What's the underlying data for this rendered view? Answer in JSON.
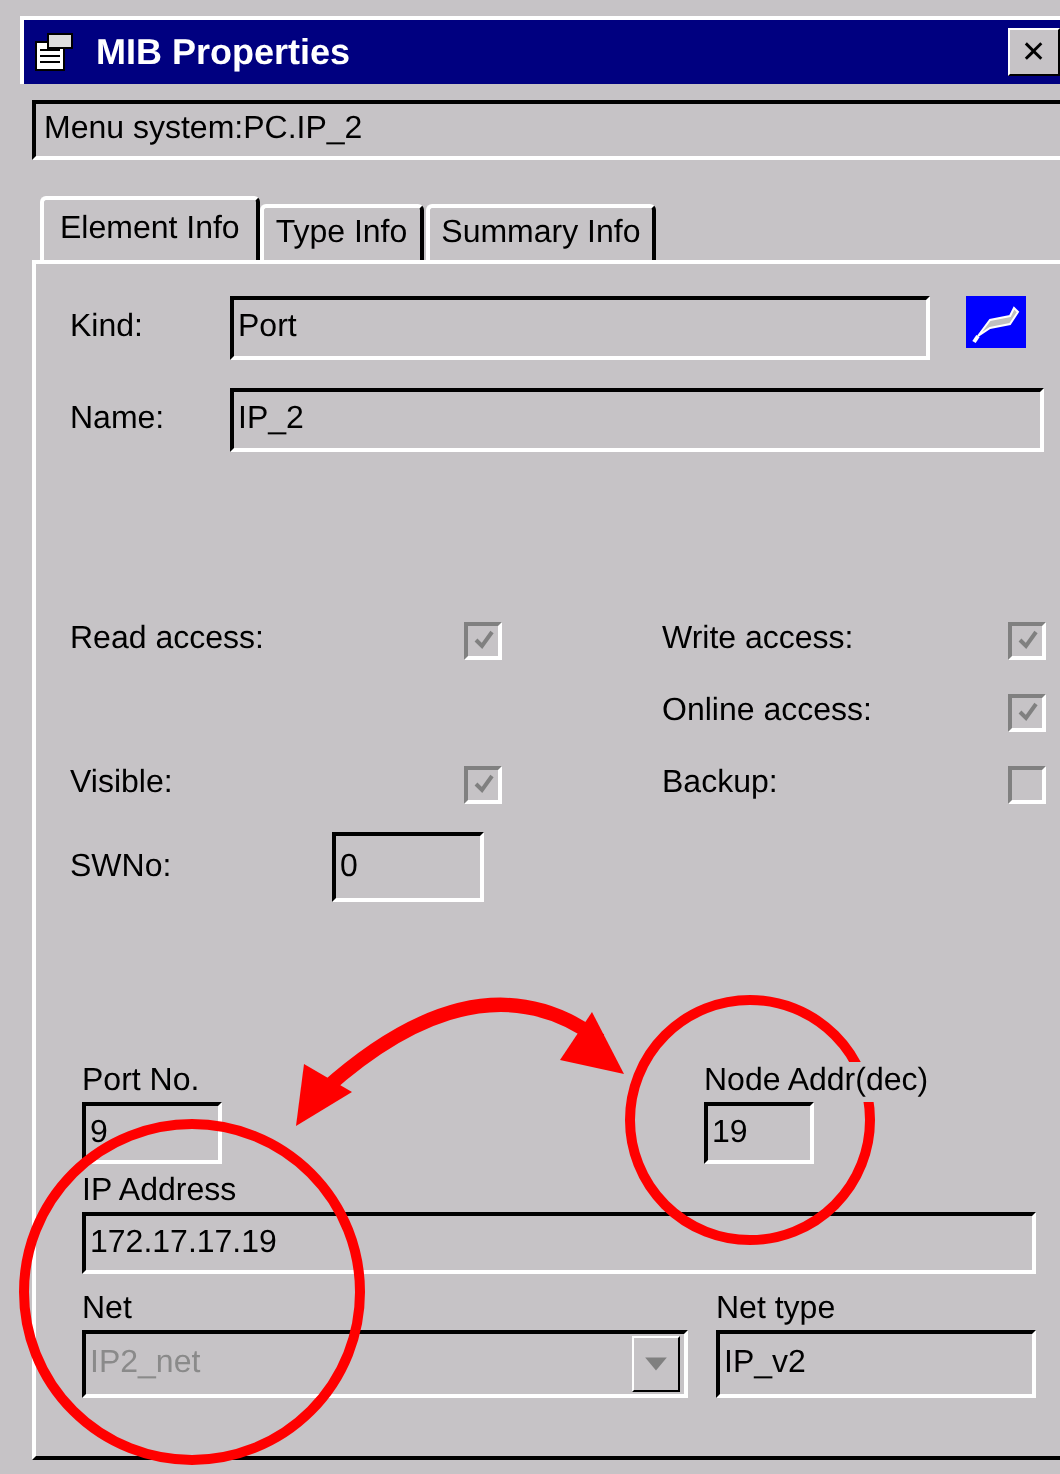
{
  "window": {
    "title": "MIB Properties",
    "close": "✕"
  },
  "path": "Menu system:PC.IP_2",
  "tabs": [
    {
      "label": "Element Info",
      "selected": true
    },
    {
      "label": "Type Info",
      "selected": false
    },
    {
      "label": "Summary Info",
      "selected": false
    }
  ],
  "kind": {
    "label": "Kind:",
    "value": "Port"
  },
  "name": {
    "label": "Name:",
    "value": "IP_2"
  },
  "checks": [
    {
      "label": "Read access:",
      "checked": true
    },
    {
      "label": "Write access:",
      "checked": true
    },
    {
      "label": "Online access:",
      "checked": true
    },
    {
      "label": "Visible:",
      "checked": true
    },
    {
      "label": "Backup:",
      "checked": false
    }
  ],
  "swno": {
    "label": "SWNo:",
    "value": "0"
  },
  "port_no": {
    "label": "Port No.",
    "value": "9"
  },
  "node_addr": {
    "label": "Node Addr(dec)",
    "value": "19"
  },
  "ip_address": {
    "label": "IP Address",
    "value": "172.17.17.19"
  },
  "net": {
    "label": "Net",
    "value": "IP2_net",
    "disabled": true
  },
  "net_type": {
    "label": "Net type",
    "value": "IP_v2"
  }
}
